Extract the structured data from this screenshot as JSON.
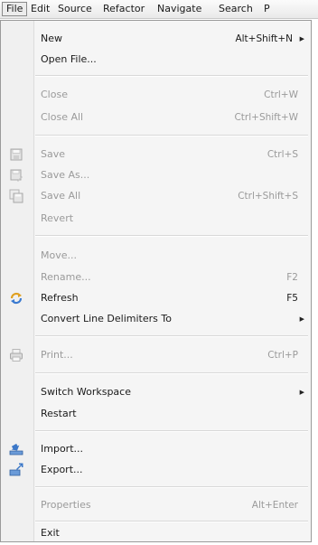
{
  "menubar": {
    "items": [
      {
        "label": "File"
      },
      {
        "label": "Edit"
      },
      {
        "label": "Source"
      },
      {
        "label": "Refactor"
      },
      {
        "label": "Navigate"
      },
      {
        "label": "Search"
      },
      {
        "label": "P"
      }
    ]
  },
  "menu": {
    "new": {
      "label": "New",
      "accel": "Alt+Shift+N",
      "arrow": "▶"
    },
    "open_file": {
      "label": "Open File..."
    },
    "close": {
      "label": "Close",
      "accel": "Ctrl+W"
    },
    "close_all": {
      "label": "Close All",
      "accel": "Ctrl+Shift+W"
    },
    "save": {
      "label": "Save",
      "accel": "Ctrl+S",
      "icon": "save-icon"
    },
    "save_as": {
      "label": "Save As...",
      "icon": "save-as-icon"
    },
    "save_all": {
      "label": "Save All",
      "accel": "Ctrl+Shift+S",
      "icon": "save-all-icon"
    },
    "revert": {
      "label": "Revert"
    },
    "move": {
      "label": "Move..."
    },
    "rename": {
      "label": "Rename...",
      "accel": "F2"
    },
    "refresh": {
      "label": "Refresh",
      "accel": "F5",
      "icon": "refresh-icon"
    },
    "convert": {
      "label": "Convert Line Delimiters To",
      "arrow": "▶"
    },
    "print": {
      "label": "Print...",
      "accel": "Ctrl+P",
      "icon": "print-icon"
    },
    "switch_workspace": {
      "label": "Switch Workspace",
      "arrow": "▶"
    },
    "restart": {
      "label": "Restart"
    },
    "import": {
      "label": "Import...",
      "icon": "import-icon"
    },
    "export": {
      "label": "Export...",
      "icon": "export-icon"
    },
    "properties": {
      "label": "Properties",
      "accel": "Alt+Enter"
    },
    "exit": {
      "label": "Exit"
    }
  }
}
